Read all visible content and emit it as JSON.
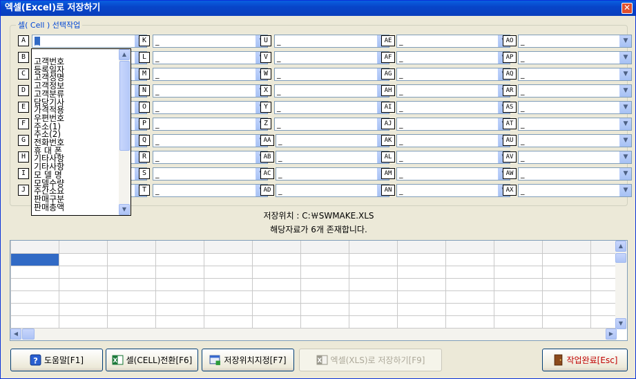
{
  "window": {
    "title": "엑셀(Excel)로 저장하기",
    "close_glyph": "✕"
  },
  "group_legend": "셀( Cell ) 선택작업",
  "columns": [
    [
      {
        "label": "A",
        "value": "_"
      },
      {
        "label": "B",
        "value": "_"
      },
      {
        "label": "C",
        "value": "_"
      },
      {
        "label": "D",
        "value": "_"
      },
      {
        "label": "E",
        "value": "_"
      },
      {
        "label": "F",
        "value": "_"
      },
      {
        "label": "G",
        "value": "_"
      },
      {
        "label": "H",
        "value": "_"
      },
      {
        "label": "I",
        "value": "_"
      },
      {
        "label": "J",
        "value": "_"
      }
    ],
    [
      {
        "label": "K",
        "value": "_"
      },
      {
        "label": "L",
        "value": "_"
      },
      {
        "label": "M",
        "value": "_"
      },
      {
        "label": "N",
        "value": "_"
      },
      {
        "label": "O",
        "value": "_"
      },
      {
        "label": "P",
        "value": "_"
      },
      {
        "label": "Q",
        "value": "_"
      },
      {
        "label": "R",
        "value": "_"
      },
      {
        "label": "S",
        "value": "_"
      },
      {
        "label": "T",
        "value": "_"
      }
    ],
    [
      {
        "label": "U",
        "value": "_"
      },
      {
        "label": "V",
        "value": "_"
      },
      {
        "label": "W",
        "value": "_"
      },
      {
        "label": "X",
        "value": "_"
      },
      {
        "label": "Y",
        "value": "_"
      },
      {
        "label": "Z",
        "value": "_"
      },
      {
        "label": "AA",
        "value": "_"
      },
      {
        "label": "AB",
        "value": "_"
      },
      {
        "label": "AC",
        "value": "_"
      },
      {
        "label": "AD",
        "value": "_"
      }
    ],
    [
      {
        "label": "AE",
        "value": "_"
      },
      {
        "label": "AF",
        "value": "_"
      },
      {
        "label": "AG",
        "value": "_"
      },
      {
        "label": "AH",
        "value": "_"
      },
      {
        "label": "AI",
        "value": "_"
      },
      {
        "label": "AJ",
        "value": "_"
      },
      {
        "label": "AK",
        "value": "_"
      },
      {
        "label": "AL",
        "value": "_"
      },
      {
        "label": "AM",
        "value": "_"
      },
      {
        "label": "AN",
        "value": "_"
      }
    ],
    [
      {
        "label": "AO",
        "value": "_"
      },
      {
        "label": "AP",
        "value": "_"
      },
      {
        "label": "AQ",
        "value": "_"
      },
      {
        "label": "AR",
        "value": "_"
      },
      {
        "label": "AS",
        "value": "_"
      },
      {
        "label": "AT",
        "value": "_"
      },
      {
        "label": "AU",
        "value": "_"
      },
      {
        "label": "AV",
        "value": "_"
      },
      {
        "label": "AW",
        "value": "_"
      },
      {
        "label": "AX",
        "value": "_"
      }
    ]
  ],
  "dropdown_items": [
    "고객번호",
    "등록일자",
    "고객성명",
    "고객정보",
    "고객분류",
    "담당기사",
    "가격적용",
    "우편번호",
    "주소(1)",
    "주소(2)",
    "전화번호",
    "휴 대 폰",
    "기타사항",
    "기타사항",
    "모 델 명",
    "모델수량",
    "주간소요",
    "판매구분",
    "판매총액"
  ],
  "save_location": "저장위치 : C:￦SWMAKE.XLS",
  "record_count": "해당자료가 6개 존재합니다.",
  "buttons": {
    "help": "도움말[F1]",
    "cell_convert": "셀(CELL)전환[F6]",
    "set_location": "저장위치지정[F7]",
    "save_excel": "엑셀(XLS)로 저장하기[F9]",
    "done": "작업완료[Esc]"
  },
  "icons": {
    "help": "help-icon",
    "excel": "excel-icon",
    "folder": "save-location-icon",
    "excel_disabled": "excel-save-icon",
    "exit": "door-exit-icon"
  },
  "colors": {
    "title_bar": "#0a52d6",
    "selection": "#316ac5",
    "done_text": "#c00000",
    "legend": "#0046d5"
  }
}
